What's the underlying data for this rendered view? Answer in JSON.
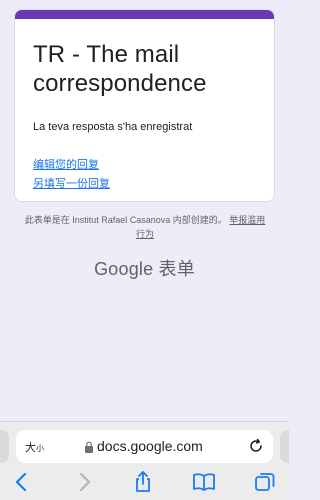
{
  "form": {
    "title": "TR - The mail correspondence",
    "confirmation": "La teva resposta s'ha enregistrat",
    "edit_link": "编辑您的回复",
    "submit_again_link": "另填写一份回复"
  },
  "footer": {
    "note": "此表单是在 Institut Rafael Casanova 内部创建的。",
    "report_link": "举报滥用行为",
    "logo_text": "Google 表单"
  },
  "browser": {
    "text_size_big": "大",
    "text_size_small": "小",
    "domain": "docs.google.com"
  },
  "colors": {
    "accent": "#673ab7",
    "background": "#f0ebf8",
    "link": "#1a73e8",
    "safari_blue": "#1a7cf5"
  },
  "icons": {
    "lock": "lock-icon",
    "reload": "reload-icon",
    "back": "chevron-left-icon",
    "forward": "chevron-right-icon",
    "share": "share-icon",
    "bookmarks": "book-icon",
    "tabs": "tabs-icon"
  }
}
